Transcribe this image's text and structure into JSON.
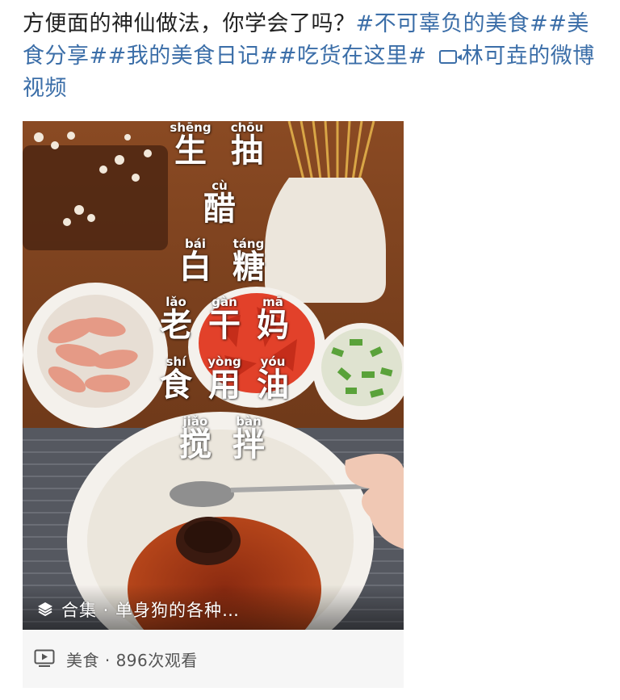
{
  "post": {
    "text": "方便面的神仙做法，你学会了吗？",
    "tags": [
      "#不可辜负的美食#",
      "#美食分享#",
      "#我的美食日记#",
      "#吃货在这里#"
    ],
    "video_link": "林可垚的微博视频"
  },
  "video": {
    "overlay": [
      {
        "pinyin": "shēng",
        "hanzi": "生"
      },
      {
        "pinyin": "chōu",
        "hanzi": "抽"
      },
      {
        "pinyin": "cù",
        "hanzi": "醋"
      },
      {
        "pinyin": "bái",
        "hanzi": "白"
      },
      {
        "pinyin": "táng",
        "hanzi": "糖"
      },
      {
        "pinyin": "lǎo",
        "hanzi": "老"
      },
      {
        "pinyin": "gàn",
        "hanzi": "干"
      },
      {
        "pinyin": "mā",
        "hanzi": "妈"
      },
      {
        "pinyin": "shí",
        "hanzi": "食"
      },
      {
        "pinyin": "yòng",
        "hanzi": "用"
      },
      {
        "pinyin": "yóu",
        "hanzi": "油"
      },
      {
        "pinyin": "jiǎo",
        "hanzi": "搅"
      },
      {
        "pinyin": "bàn",
        "hanzi": "拌"
      }
    ],
    "collection_label": "合集 · 单身狗的各种…"
  },
  "meta": {
    "text": "美食 · 896次观看"
  },
  "colors": {
    "link": "#3b6ea8",
    "text": "#222222",
    "meta_bg": "#f6f6f6"
  }
}
